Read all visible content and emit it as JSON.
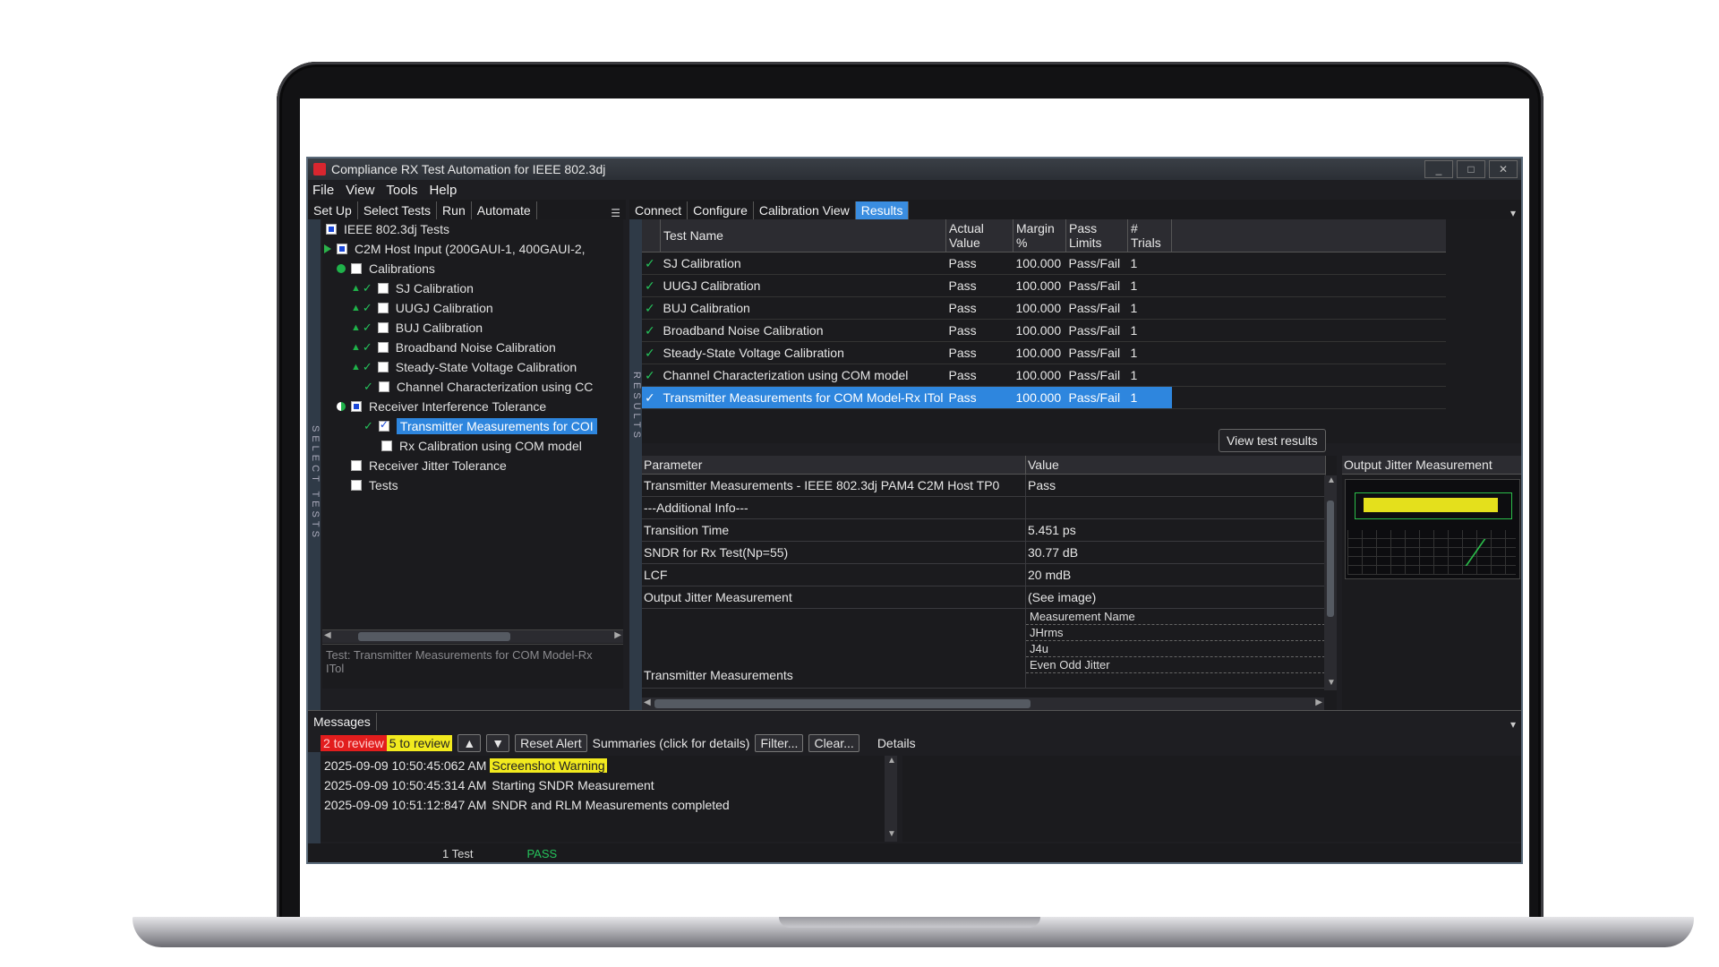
{
  "window": {
    "title": "Compliance RX Test Automation for IEEE 802.3dj",
    "minimize": "_",
    "maximize": "□",
    "close": "✕"
  },
  "menu": [
    "File",
    "View",
    "Tools",
    "Help"
  ],
  "left_tabs": [
    "Set Up",
    "Select Tests",
    "Run",
    "Automate"
  ],
  "left_vertical_label": "SELECT TESTS",
  "tree": [
    {
      "label": "IEEE 802.3dj Tests"
    },
    {
      "label": "C2M Host Input (200GAUI-1, 400GAUI-2,"
    },
    {
      "label": "Calibrations"
    },
    {
      "label": "SJ Calibration"
    },
    {
      "label": "UUGJ Calibration"
    },
    {
      "label": "BUJ Calibration"
    },
    {
      "label": "Broadband Noise Calibration"
    },
    {
      "label": "Steady-State Voltage Calibration"
    },
    {
      "label": "Channel Characterization using CC"
    },
    {
      "label": "Receiver Interference Tolerance"
    },
    {
      "label": "Transmitter Measurements for COI"
    },
    {
      "label": "Rx Calibration using COM model"
    },
    {
      "label": "Receiver Jitter Tolerance"
    },
    {
      "label": "Tests"
    }
  ],
  "test_info": "Test: Transmitter Measurements for COM Model-Rx ITol",
  "right_tabs": [
    "Connect",
    "Configure",
    "Calibration View",
    "Results"
  ],
  "results_vertical_label": "RESULTS",
  "results": {
    "columns": [
      "Test Name",
      "Actual Value",
      "Margin %",
      "Pass Limits",
      "# Trials"
    ],
    "rows": [
      {
        "name": "SJ Calibration",
        "actual": "Pass",
        "margin": "100.000",
        "limits": "Pass/Fail",
        "trials": "1"
      },
      {
        "name": "UUGJ Calibration",
        "actual": "Pass",
        "margin": "100.000",
        "limits": "Pass/Fail",
        "trials": "1"
      },
      {
        "name": "BUJ Calibration",
        "actual": "Pass",
        "margin": "100.000",
        "limits": "Pass/Fail",
        "trials": "1"
      },
      {
        "name": "Broadband Noise Calibration",
        "actual": "Pass",
        "margin": "100.000",
        "limits": "Pass/Fail",
        "trials": "1"
      },
      {
        "name": "Steady-State Voltage Calibration",
        "actual": "Pass",
        "margin": "100.000",
        "limits": "Pass/Fail",
        "trials": "1"
      },
      {
        "name": "Channel Characterization using COM model",
        "actual": "Pass",
        "margin": "100.000",
        "limits": "Pass/Fail",
        "trials": "1"
      },
      {
        "name": "Transmitter Measurements for COM Model-Rx ITol",
        "actual": "Pass",
        "margin": "100.000",
        "limits": "Pass/Fail",
        "trials": "1"
      }
    ]
  },
  "view_results_button": "View test results",
  "details": {
    "columns": [
      "Parameter",
      "Value"
    ],
    "rows": [
      {
        "param": "Transmitter Measurements - IEEE 802.3dj PAM4 C2M Host TP0",
        "value": "Pass"
      },
      {
        "param": "---Additional Info---",
        "value": ""
      },
      {
        "param": "Transition Time",
        "value": "5.451 ps"
      },
      {
        "param": "SNDR for Rx Test(Np=55)",
        "value": "30.77 dB"
      },
      {
        "param": "LCF",
        "value": "20 mdB"
      },
      {
        "param": "Output Jitter Measurement",
        "value": "(See image)"
      }
    ],
    "tx_param": "Transmitter Measurements",
    "tx_subitems": [
      "Measurement Name",
      "JHrms",
      "J4u",
      "Even Odd Jitter"
    ]
  },
  "jitter_panel_title": "Output Jitter Measurement",
  "messages": {
    "tab": "Messages",
    "badge_red": "2 to review",
    "badge_yellow": "5 to review",
    "reset_alert": "Reset Alert",
    "summaries": "Summaries (click for details)",
    "filter": "Filter...",
    "clear": "Clear...",
    "details": "Details",
    "log": [
      {
        "time": "2025-09-09 10:50:45:062 AM",
        "text": "",
        "highlight": "Screenshot Warning"
      },
      {
        "time": "2025-09-09 10:50:45:314 AM",
        "text": "Starting SNDR Measurement",
        "highlight": ""
      },
      {
        "time": "2025-09-09 10:51:12:847 AM",
        "text": "SNDR and RLM Measurements completed",
        "highlight": ""
      }
    ]
  },
  "status": {
    "tests": "1 Test",
    "result": "PASS"
  }
}
